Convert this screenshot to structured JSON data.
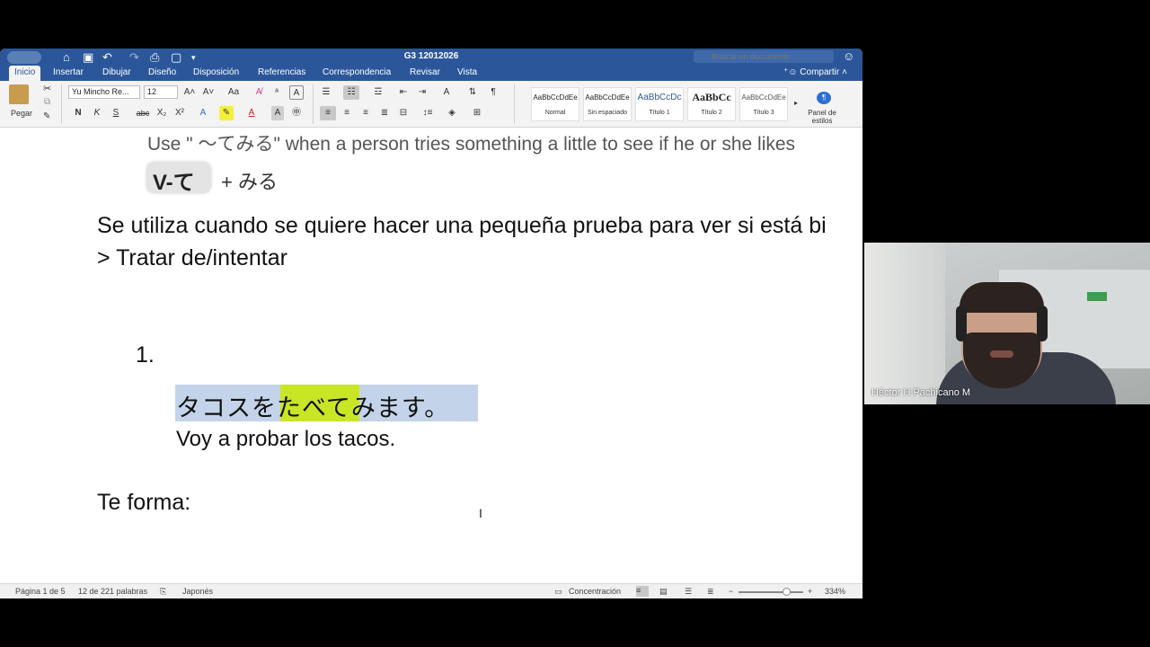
{
  "window": {
    "title": "G3 12012026",
    "search_placeholder": "Buscar en documento",
    "share_label": "Compartir"
  },
  "tabs": [
    "Inicio",
    "Insertar",
    "Dibujar",
    "Diseño",
    "Disposición",
    "Referencias",
    "Correspondencia",
    "Revisar",
    "Vista"
  ],
  "ribbon": {
    "paste_label": "Pegar",
    "font_name": "Yu Mincho Re...",
    "font_size": "12",
    "bold": "N",
    "italic": "K",
    "underline": "S",
    "strike": "abc",
    "subscript": "X₂",
    "superscript": "X²",
    "styles": [
      {
        "sample": "AaBbCcDdEe",
        "name": "Normal"
      },
      {
        "sample": "AaBbCcDdEe",
        "name": "Sin espaciado"
      },
      {
        "sample": "AaBbCcDc",
        "name": "Título 1"
      },
      {
        "sample": "AaBbCc",
        "name": "Título 2"
      },
      {
        "sample": "AaBbCcDdEe",
        "name": "Título 3"
      }
    ],
    "styles_pane_line1": "Panel de",
    "styles_pane_line2": "estilos"
  },
  "document": {
    "hint_line": "Use \" ～てみる\" when a person tries something a little to see if he or she likes",
    "pattern_verb": "V-て",
    "pattern_rest": "+ みる",
    "explanation_line1": "Se utiliza cuando se quiere hacer una pequeña prueba para ver si está bi",
    "explanation_line2": "> Tratar de/intentar",
    "example_number": "1.",
    "example_jp": "タコスをたべてみます。",
    "example_es": "Voy a probar los tacos.",
    "te_form_heading": "Te forma:"
  },
  "statusbar": {
    "page": "Página 1 de 5",
    "words": "12 de 221 palabras",
    "language": "Japonés",
    "focus": "Concentración",
    "zoom": "334%"
  },
  "video": {
    "participant_name": "Héctor H Pachicano M"
  },
  "colors": {
    "ribbon_blue": "#2b579a",
    "highlight_blue": "#c3d4ea",
    "highlight_green": "#c9e626"
  }
}
